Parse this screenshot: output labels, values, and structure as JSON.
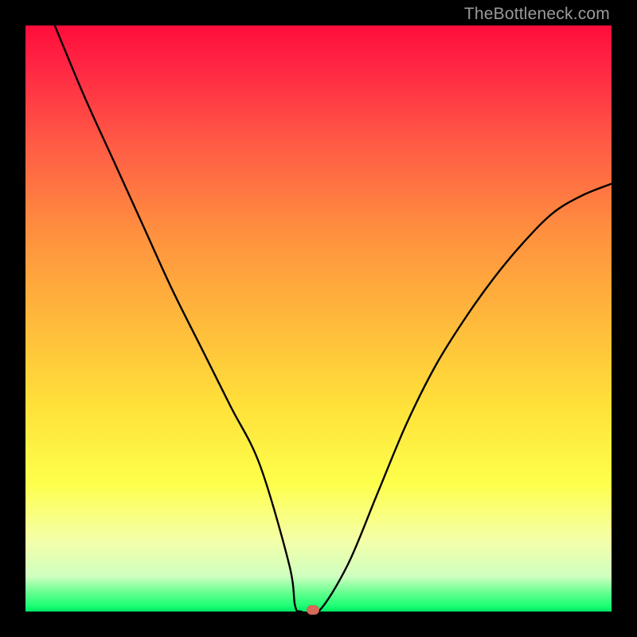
{
  "watermark": "TheBottleneck.com",
  "chart_data": {
    "type": "line",
    "title": "",
    "xlabel": "",
    "ylabel": "",
    "xlim": [
      0,
      100
    ],
    "ylim": [
      0,
      100
    ],
    "series": [
      {
        "name": "bottleneck-curve",
        "x": [
          5,
          10,
          15,
          20,
          25,
          30,
          35,
          40,
          45,
          46,
          47,
          50,
          55,
          60,
          65,
          70,
          75,
          80,
          85,
          90,
          95,
          100
        ],
        "values": [
          100,
          88,
          77,
          66,
          55,
          45,
          35,
          25,
          8,
          1,
          0,
          0,
          8,
          20,
          32,
          42,
          50,
          57,
          63,
          68,
          71,
          73
        ]
      }
    ],
    "marker": {
      "x": 49,
      "y": 0,
      "color": "#d86a5a"
    },
    "gradient_stops": [
      {
        "pos": 0.0,
        "color": "#ff0d3b"
      },
      {
        "pos": 0.5,
        "color": "#ffe13a"
      },
      {
        "pos": 0.95,
        "color": "#5dff8c"
      },
      {
        "pos": 1.0,
        "color": "#00e765"
      }
    ]
  }
}
